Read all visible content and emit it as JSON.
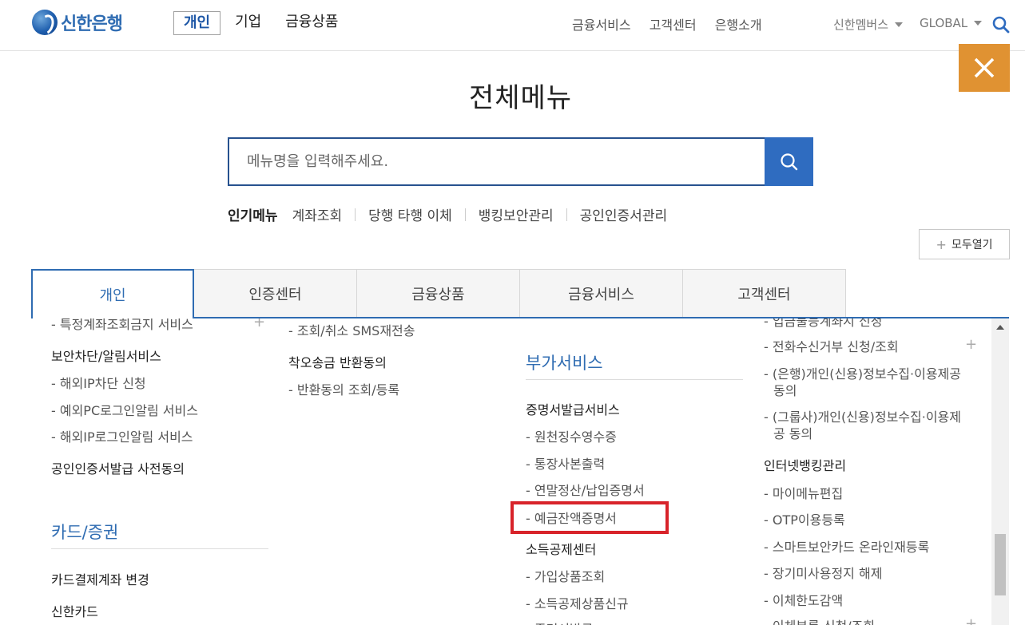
{
  "header": {
    "logo_text": "신한은행",
    "gnb": [
      "개인",
      "기업",
      "금융상품"
    ],
    "util_links": [
      "금융서비스",
      "고객센터",
      "은행소개"
    ],
    "members": "신한멤버스",
    "global": "GLOBAL"
  },
  "main": {
    "title": "전체메뉴",
    "search_placeholder": "메뉴명을 입력해주세요.",
    "popular_label": "인기메뉴",
    "popular_items": [
      "계좌조회",
      "당행 타행 이체",
      "뱅킹보안관리",
      "공인인증서관리"
    ],
    "open_all": "모두열기"
  },
  "tabs": [
    "개인",
    "인증센터",
    "금융상품",
    "금융서비스",
    "고객센터"
  ],
  "col1": {
    "cut_top": "- 특정계좌조회금지 서비스",
    "group1": "보안차단/알림서비스",
    "group1_items": [
      "- 해외IP차단 신청",
      "- 예외PC로그인알림 서비스",
      "- 해외IP로그인알림 서비스"
    ],
    "group2": "공인인증서발급 사전동의",
    "section": "카드/증권",
    "items": [
      "카드결제계좌 변경",
      "신한카드"
    ]
  },
  "col2": {
    "cut_top": "- 조회/취소 SMS재전송",
    "group": "착오송금 반환동의",
    "group_items": [
      "- 반환동의 조회/등록"
    ]
  },
  "col3": {
    "section": "부가서비스",
    "group1": "증명서발급서비스",
    "group1_items": [
      "- 원천징수영수증",
      "- 통장사본출력",
      "- 연말정산/납입증명서",
      "- 예금잔액증명서"
    ],
    "group2": "소득공제센터",
    "group2_items": [
      "- 가입상품조회",
      "- 소득공제상품신규",
      "- 증명서발급"
    ]
  },
  "col4": {
    "cut_top": "- 입금불능계좌지 신청",
    "items_a": [
      "- 전화수신거부 신청/조회"
    ],
    "consent1_l1": "- (은행)개인(신용)정보수집·이용제공",
    "consent1_l2": "동의",
    "consent2_l1": "- (그룹사)개인(신용)정보수집·이용제",
    "consent2_l2": "공 동의",
    "group": "인터넷뱅킹관리",
    "group_items": [
      "- 마이메뉴편집",
      "- OTP이용등록",
      "- 스마트보안카드 온라인재등록",
      "- 장기미사용정지 해제",
      "- 이체한도감액",
      "- 이체부록 신청/조회"
    ]
  },
  "colors": {
    "brand_blue": "#2f6cb2",
    "close_orange": "#e09232",
    "highlight_red": "#d8232a"
  }
}
